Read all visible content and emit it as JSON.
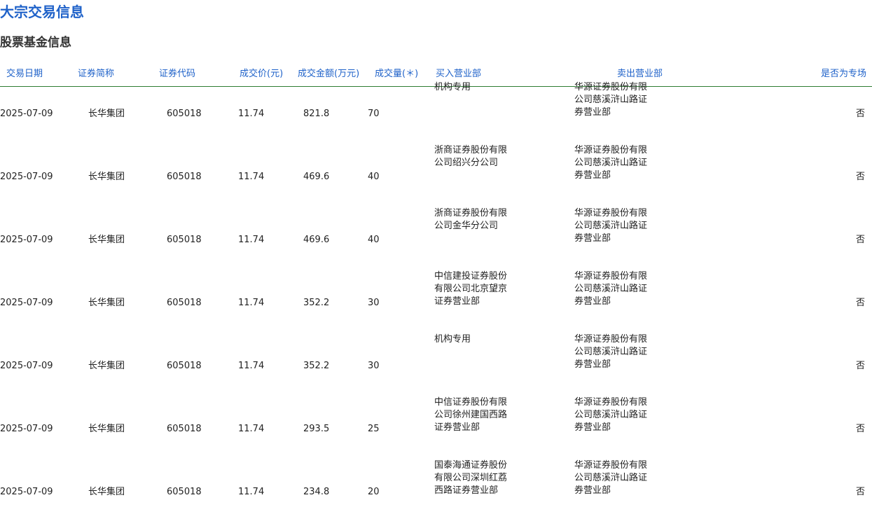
{
  "page_title": "大宗交易信息",
  "section_title": "股票基金信息",
  "table": {
    "columns": [
      "交易日期",
      "证券简称",
      "证券代码",
      "成交价(元)",
      "成交金额(万元)",
      "成交量(＊)",
      "买入营业部",
      "卖出营业部",
      "是否为专场"
    ],
    "rows": [
      [
        "2025-07-09",
        "长华集团",
        "605018",
        "11.74",
        "821.8",
        "70",
        "机构专用",
        "华源证券股份有限公司慈溪浒山路证券营业部",
        "否"
      ],
      [
        "2025-07-09",
        "长华集团",
        "605018",
        "11.74",
        "469.6",
        "40",
        "浙商证券股份有限公司绍兴分公司",
        "华源证券股份有限公司慈溪浒山路证券营业部",
        "否"
      ],
      [
        "2025-07-09",
        "长华集团",
        "605018",
        "11.74",
        "469.6",
        "40",
        "浙商证券股份有限公司金华分公司",
        "华源证券股份有限公司慈溪浒山路证券营业部",
        "否"
      ],
      [
        "2025-07-09",
        "长华集团",
        "605018",
        "11.74",
        "352.2",
        "30",
        "中信建投证券股份有限公司北京望京证券营业部",
        "华源证券股份有限公司慈溪浒山路证券营业部",
        "否"
      ],
      [
        "2025-07-09",
        "长华集团",
        "605018",
        "11.74",
        "352.2",
        "30",
        "机构专用",
        "华源证券股份有限公司慈溪浒山路证券营业部",
        "否"
      ],
      [
        "2025-07-09",
        "长华集团",
        "605018",
        "11.74",
        "293.5",
        "25",
        "中信证券股份有限公司徐州建国西路证券营业部",
        "华源证券股份有限公司慈溪浒山路证券营业部",
        "否"
      ],
      [
        "2025-07-09",
        "长华集团",
        "605018",
        "11.74",
        "234.8",
        "20",
        "国泰海通证券股份有限公司深圳红荔西路证券营业部",
        "华源证券股份有限公司慈溪浒山路证券营业部",
        "否"
      ]
    ]
  },
  "colors": {
    "title": "#1f62c9",
    "header_text": "#1f62c9",
    "header_rule": "#2e7d32"
  }
}
